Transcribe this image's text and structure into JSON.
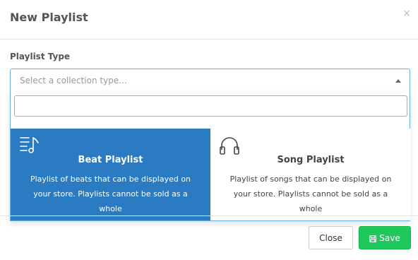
{
  "modal": {
    "title": "New Playlist",
    "close_glyph": "×"
  },
  "form": {
    "field_label": "Playlist Type",
    "select": {
      "placeholder": "Select a collection type..."
    },
    "search": {
      "value": "",
      "placeholder": ""
    }
  },
  "options": [
    {
      "title": "Beat Playlist",
      "description": "Playlist of beats that can be displayed on your store. Playlists cannot be sold as a whole",
      "icon": "music-list-icon",
      "highlighted": true
    },
    {
      "title": "Song Playlist",
      "description": "Playlist of songs that can be displayed on your store. Playlists cannot be sold as a whole",
      "icon": "headphones-icon",
      "highlighted": false
    }
  ],
  "footer": {
    "close_label": "Close",
    "save_label": "Save",
    "save_icon": "floppy-disk-icon"
  },
  "colors": {
    "highlight": "#2a7bc1",
    "save_button": "#1ec85a",
    "focus_border": "#66afe9"
  }
}
